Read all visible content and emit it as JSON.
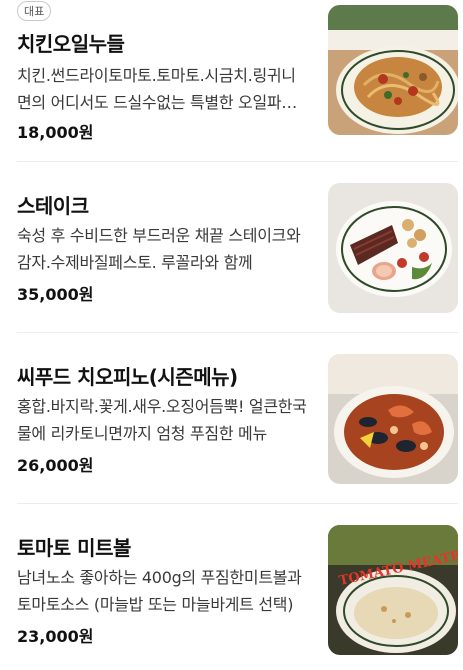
{
  "menu": {
    "items": [
      {
        "badge": "대표",
        "name": "치킨오일누들",
        "description": "치킨.썬드라이토마토.토마토.시금치.링귀니면의 어디서도 드실수없는 특별한 오일파스타",
        "price": "18,000원",
        "image": "plate-icon"
      },
      {
        "badge": "",
        "name": "스테이크",
        "description": "숙성 후 수비드한 부드러운 채끝 스테이크와 감자.수제바질페스토. 루꼴라와 함께",
        "price": "35,000원",
        "image": "plate-icon"
      },
      {
        "badge": "",
        "name": "씨푸드 치오피노(시즌메뉴)",
        "description": "홍합.바지락.꽃게.새우.오징어듬뿍! 얼큰한국물에 리카토니면까지 엄청 푸짐한 메뉴",
        "price": "26,000원",
        "image": "plate-icon"
      },
      {
        "badge": "",
        "name": "토마토 미트볼",
        "description": "남녀노소 좋아하는 400g의 푸짐한미트볼과 토마토소스 (마늘밥 또는 마늘바게트 선택)",
        "price": "23,000원",
        "image": "plate-icon",
        "image_text": "TOMATO MEATBALLS"
      }
    ]
  }
}
